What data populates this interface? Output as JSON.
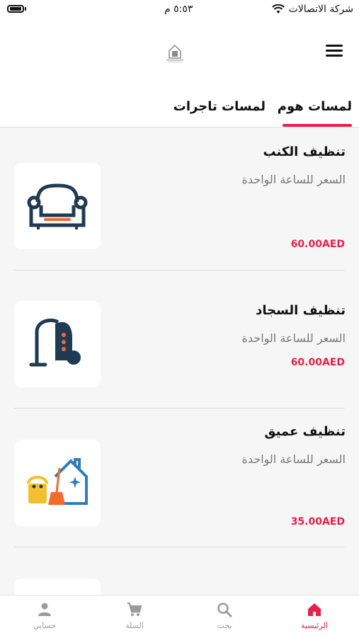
{
  "status_bar": {
    "carrier": "شركة الاتصالات",
    "time": "٥:٥٣ م"
  },
  "tabs": [
    {
      "label": "لمسات هوم",
      "active": true
    },
    {
      "label": "لمسات تاجرات",
      "active": false
    }
  ],
  "services": [
    {
      "title": "تنظيف الكنب",
      "subtitle": "السعر للساعة الواحدة",
      "price": "60.00AED",
      "icon": "sofa-icon"
    },
    {
      "title": "تنظيف السجاد",
      "subtitle": "السعر للساعة الواحدة",
      "price": "60.00AED",
      "icon": "vacuum-cleaner-icon"
    },
    {
      "title": "تنظيف عميق",
      "subtitle": "السعر للساعة الواحدة",
      "price": "35.00AED",
      "icon": "house-cleaning-icon"
    }
  ],
  "bottom_nav": [
    {
      "label": "الرئيسية",
      "icon": "home-icon",
      "active": true
    },
    {
      "label": "بحث",
      "icon": "search-icon",
      "active": false
    },
    {
      "label": "السلة",
      "icon": "cart-icon",
      "active": false
    },
    {
      "label": "حسابي",
      "icon": "person-icon",
      "active": false
    }
  ],
  "colors": {
    "accent": "#e8204a",
    "icon_navy": "#1f3a52",
    "icon_orange": "#f26a2e"
  }
}
